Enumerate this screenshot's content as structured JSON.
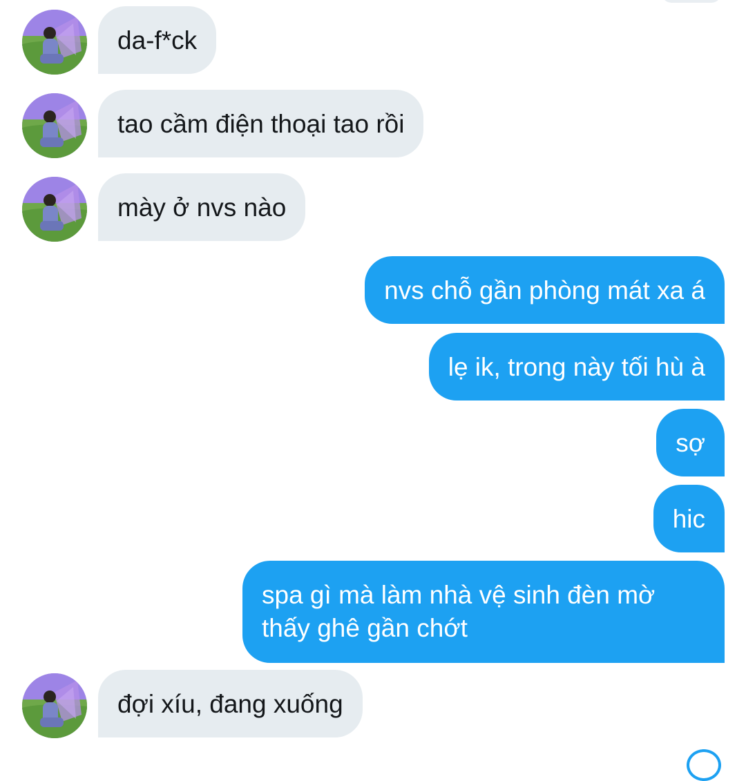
{
  "conversation": {
    "contact_avatar": "profile-photo-fairy-wings-icon",
    "messages": [
      {
        "direction": "in",
        "text": "da-f*ck"
      },
      {
        "direction": "in",
        "text": "tao cầm điện thoại tao rồi"
      },
      {
        "direction": "in",
        "text": "mày ở nvs nào"
      },
      {
        "direction": "out",
        "text": "nvs chỗ gần phòng mát xa á"
      },
      {
        "direction": "out",
        "text": "lẹ ik, trong này tối hù à"
      },
      {
        "direction": "out",
        "text": "sợ"
      },
      {
        "direction": "out",
        "text": "hic"
      },
      {
        "direction": "out",
        "text": "spa gì mà làm nhà vệ sinh đèn mờ thấy ghê gần chớt"
      },
      {
        "direction": "in",
        "text": "đợi xíu, đang xuống"
      }
    ]
  },
  "colors": {
    "incoming_bubble": "#e6ecf0",
    "incoming_text": "#14171a",
    "outgoing_bubble": "#1da1f2",
    "outgoing_text": "#ffffff"
  }
}
